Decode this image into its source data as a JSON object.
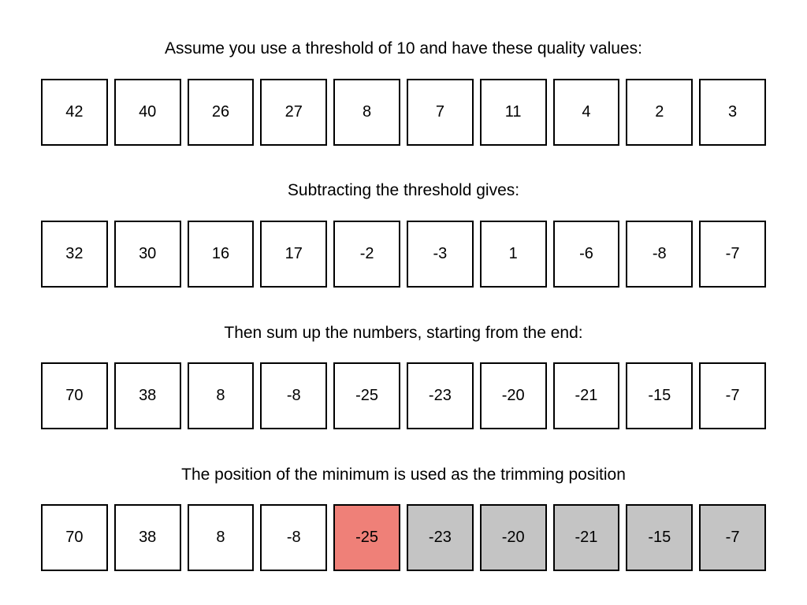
{
  "colors": {
    "minimum": "#ef8078",
    "trimmed": "#c4c4c4",
    "border": "#000000",
    "background": "#ffffff"
  },
  "steps": [
    {
      "caption": "Assume you use a threshold of 10 and have these quality values:",
      "values": [
        "42",
        "40",
        "26",
        "27",
        "8",
        "7",
        "11",
        "4",
        "2",
        "3"
      ],
      "states": [
        "normal",
        "normal",
        "normal",
        "normal",
        "normal",
        "normal",
        "normal",
        "normal",
        "normal",
        "normal"
      ]
    },
    {
      "caption": "Subtracting the threshold gives:",
      "values": [
        "32",
        "30",
        "16",
        "17",
        "-2",
        "-3",
        "1",
        "-6",
        "-8",
        "-7"
      ],
      "states": [
        "normal",
        "normal",
        "normal",
        "normal",
        "normal",
        "normal",
        "normal",
        "normal",
        "normal",
        "normal"
      ]
    },
    {
      "caption": "Then sum up the numbers, starting from the end:",
      "values": [
        "70",
        "38",
        "8",
        "-8",
        "-25",
        "-23",
        "-20",
        "-21",
        "-15",
        "-7"
      ],
      "states": [
        "normal",
        "normal",
        "normal",
        "normal",
        "normal",
        "normal",
        "normal",
        "normal",
        "normal",
        "normal"
      ]
    },
    {
      "caption": "The position of the minimum is used as the trimming position",
      "values": [
        "70",
        "38",
        "8",
        "-8",
        "-25",
        "-23",
        "-20",
        "-21",
        "-15",
        "-7"
      ],
      "states": [
        "normal",
        "normal",
        "normal",
        "normal",
        "minimum",
        "trimmed",
        "trimmed",
        "trimmed",
        "trimmed",
        "trimmed"
      ]
    }
  ]
}
